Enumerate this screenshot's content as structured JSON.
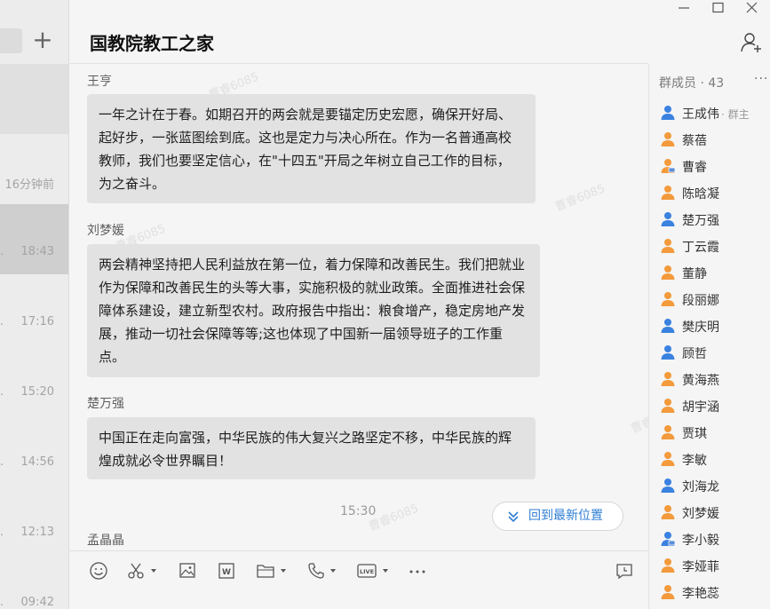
{
  "conversations": [
    {
      "time": "",
      "state": "active1"
    },
    {
      "time": "16分钟前",
      "state": ""
    },
    {
      "time": "18:43",
      "state": "active2"
    },
    {
      "time": "17:16",
      "state": ""
    },
    {
      "time": "15:20",
      "state": ""
    },
    {
      "time": "14:56",
      "state": ""
    },
    {
      "time": "12:13",
      "state": ""
    },
    {
      "time": "09:42",
      "state": ""
    }
  ],
  "chat": {
    "title": "国教院教工之家",
    "messages": [
      {
        "sender": "王亨",
        "text": "一年之计在于春。如期召开的两会就是要锚定历史宏愿，确保开好局、起好步，一张蓝图绘到底。这也是定力与决心所在。作为一名普通高校教师，我们也要坚定信心，在\"十四五\"开局之年树立自己工作的目标，为之奋斗。"
      },
      {
        "sender": "刘梦媛",
        "text": "两会精神坚持把人民利益放在第一位，着力保障和改善民生。我们把就业作为保障和改善民生的头等大事，实施积极的就业政策。全面推进社会保障体系建设，建立新型农村。政府报告中指出：粮食增产，稳定房地产发展，推动一切社会保障等等;这也体现了中国新一届领导班子的工作重点。"
      },
      {
        "sender": "楚万强",
        "text": "中国正在走向富强，中华民族的伟大复兴之路坚定不移，中华民族的辉煌成就必令世界瞩目！"
      },
      {
        "sender": "孟晶晶",
        "text": ""
      }
    ],
    "time_label": "15:30",
    "back_to_latest": "回到最新位置",
    "watermark": "曹睿6085"
  },
  "members": {
    "header": "群成员 · 43",
    "owner_role": "· 群主",
    "list": [
      {
        "name": "王成伟",
        "gender": "male",
        "owner": true
      },
      {
        "name": "蔡蓓",
        "gender": "female"
      },
      {
        "name": "曹睿",
        "gender": "female-pc"
      },
      {
        "name": "陈晗凝",
        "gender": "female"
      },
      {
        "name": "楚万强",
        "gender": "male"
      },
      {
        "name": "丁云霞",
        "gender": "female"
      },
      {
        "name": "董静",
        "gender": "female"
      },
      {
        "name": "段丽娜",
        "gender": "female"
      },
      {
        "name": "樊庆明",
        "gender": "male"
      },
      {
        "name": "顾哲",
        "gender": "male"
      },
      {
        "name": "黄海燕",
        "gender": "female"
      },
      {
        "name": "胡宇涵",
        "gender": "female"
      },
      {
        "name": "贾琪",
        "gender": "female"
      },
      {
        "name": "李敏",
        "gender": "female"
      },
      {
        "name": "刘海龙",
        "gender": "male"
      },
      {
        "name": "刘梦媛",
        "gender": "female"
      },
      {
        "name": "李小毅",
        "gender": "male-pc"
      },
      {
        "name": "李娅菲",
        "gender": "female"
      },
      {
        "name": "李艳蕊",
        "gender": "female"
      }
    ]
  },
  "colors": {
    "male": "#3b82e0",
    "female": "#f39a3c",
    "accent": "#2f7fd6"
  }
}
